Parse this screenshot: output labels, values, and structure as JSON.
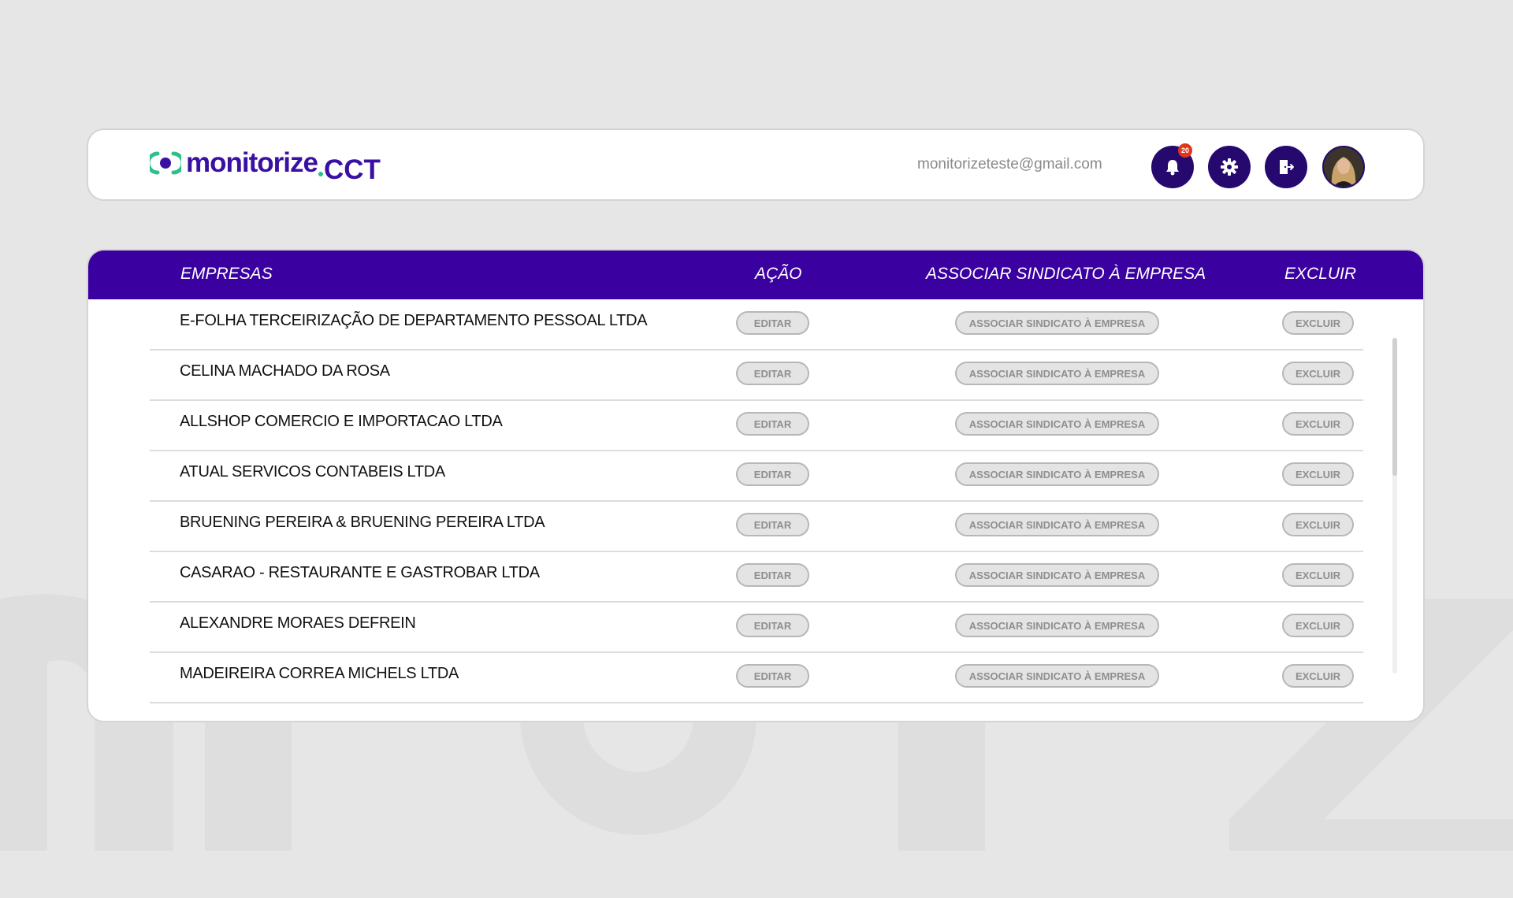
{
  "brand": {
    "name": "monitorize",
    "product": "CCT",
    "primary_color": "#3a00a0",
    "accent_color": "#2ec08c"
  },
  "header": {
    "user_email": "monitorizeteste@gmail.com",
    "notifications": {
      "icon": "bell-icon",
      "count": "20"
    },
    "settings_icon": "gear-icon",
    "logout_icon": "logout-icon"
  },
  "table": {
    "columns": {
      "company": "EMPRESAS",
      "action": "AÇÃO",
      "associate": "ASSOCIAR  SINDICATO À EMPRESA",
      "delete": "EXCLUIR"
    },
    "edit_label": "EDITAR",
    "associate_label": "ASSOCIAR SINDICATO À EMPRESA",
    "delete_label": "EXCLUIR",
    "rows": [
      {
        "company": "E-FOLHA TERCEIRIZAÇÃO DE DEPARTAMENTO PESSOAL LTDA"
      },
      {
        "company": "CELINA MACHADO DA ROSA"
      },
      {
        "company": "ALLSHOP COMERCIO E IMPORTACAO LTDA"
      },
      {
        "company": "ATUAL SERVICOS CONTABEIS LTDA"
      },
      {
        "company": "BRUENING PEREIRA & BRUENING PEREIRA LTDA"
      },
      {
        "company": "CASARAO - RESTAURANTE E GASTROBAR LTDA"
      },
      {
        "company": "ALEXANDRE MORAES DEFREIN"
      },
      {
        "company": "MADEIREIRA CORREA MICHELS LTDA"
      }
    ]
  }
}
